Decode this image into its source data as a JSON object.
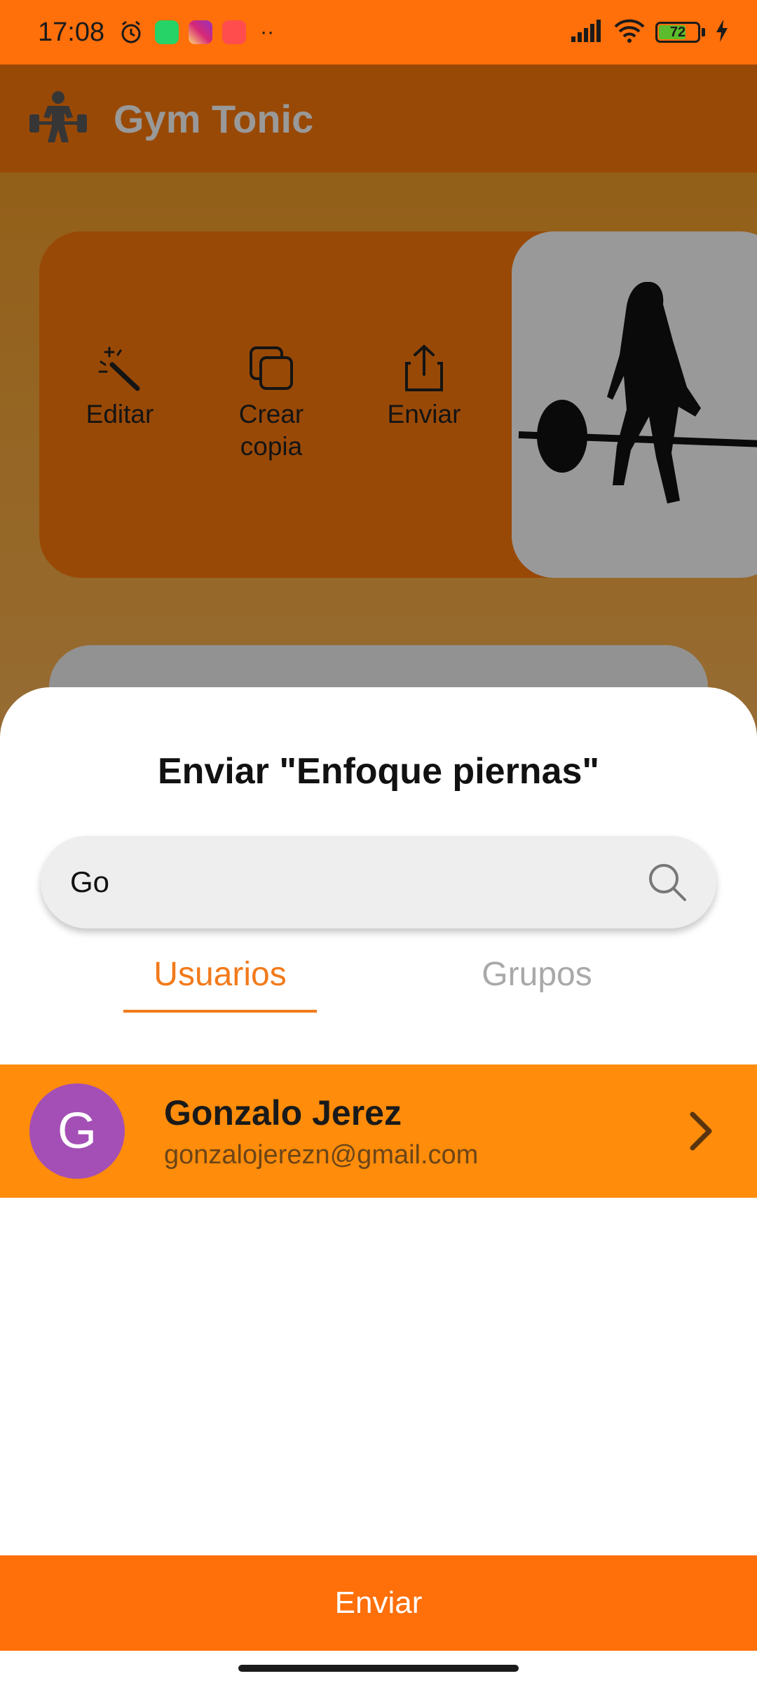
{
  "status_bar": {
    "time": "17:08",
    "battery_level": "72",
    "battery_fraction": 0.72,
    "icons": [
      "alarm-icon",
      "whatsapp-icon",
      "instagram-icon",
      "video-call-icon",
      "more-dots-icon",
      "signal-icon",
      "wifi-icon",
      "battery-icon",
      "charging-icon"
    ]
  },
  "app_bar": {
    "title": "Gym Tonic",
    "logo_icon": "bodybuilder-icon"
  },
  "routine_card": {
    "actions": [
      {
        "label": "Editar",
        "icon": "magic-wand-icon"
      },
      {
        "label": "Crear copia",
        "icon": "copy-icon"
      },
      {
        "label": "Enviar",
        "icon": "share-icon"
      }
    ],
    "image_icon": "deadlift-silhouette-icon"
  },
  "sheet": {
    "title": "Enviar \"Enfoque piernas\"",
    "search": {
      "value": "Go",
      "icon": "search-icon"
    },
    "tabs": [
      {
        "label": "Usuarios",
        "selected": true
      },
      {
        "label": "Grupos",
        "selected": false
      }
    ],
    "results": [
      {
        "initial": "G",
        "name": "Gonzalo Jerez",
        "email": "gonzalojerezn@gmail.com",
        "selected": true
      }
    ],
    "send_label": "Enviar"
  },
  "colors": {
    "primary": "#ff6f0a",
    "selected_row": "#ff8c0a",
    "tab_active": "#f27a1a",
    "tab_inactive": "#a9a9a9",
    "avatar": "#a44fb6"
  }
}
